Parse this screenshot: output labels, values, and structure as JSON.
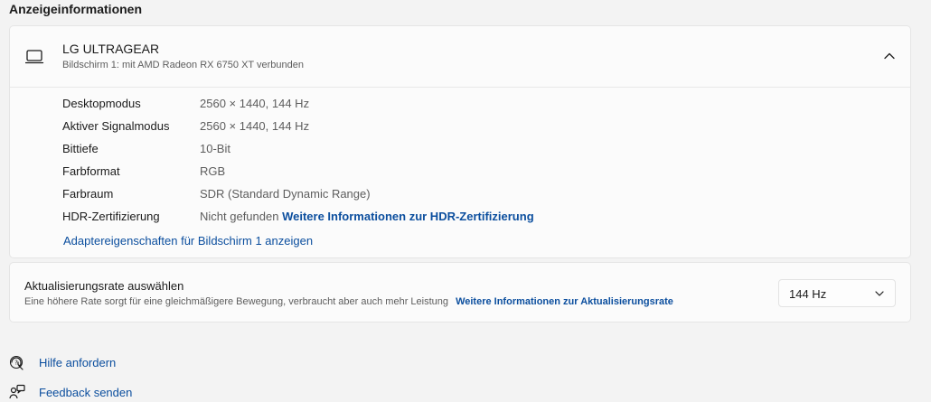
{
  "section_title": "Anzeigeinformationen",
  "display": {
    "icon": "monitor-icon",
    "name": "LG ULTRAGEAR",
    "subtitle": "Bildschirm 1: mit AMD Radeon RX 6750 XT verbunden",
    "rows": [
      {
        "label": "Desktopmodus",
        "value": "2560 × 1440, 144 Hz"
      },
      {
        "label": "Aktiver Signalmodus",
        "value": "2560 × 1440, 144 Hz"
      },
      {
        "label": "Bittiefe",
        "value": "10-Bit"
      },
      {
        "label": "Farbformat",
        "value": "RGB"
      },
      {
        "label": "Farbraum",
        "value": "SDR (Standard Dynamic Range)"
      },
      {
        "label": "HDR-Zertifizierung",
        "value": "Nicht gefunden",
        "link": "Weitere Informationen zur HDR-Zertifizierung"
      }
    ],
    "adapter_link": "Adaptereigenschaften für Bildschirm 1 anzeigen"
  },
  "refresh": {
    "title": "Aktualisierungsrate auswählen",
    "subtitle": "Eine höhere Rate sorgt für eine gleichmäßigere Bewegung, verbraucht aber auch mehr Leistung",
    "link": "Weitere Informationen zur Aktualisierungsrate",
    "selected": "144 Hz"
  },
  "help": {
    "get_help": "Hilfe anfordern",
    "feedback": "Feedback senden"
  },
  "colors": {
    "background": "#f3f3f3",
    "card": "#fbfbfb",
    "link": "#0b4e9e"
  }
}
